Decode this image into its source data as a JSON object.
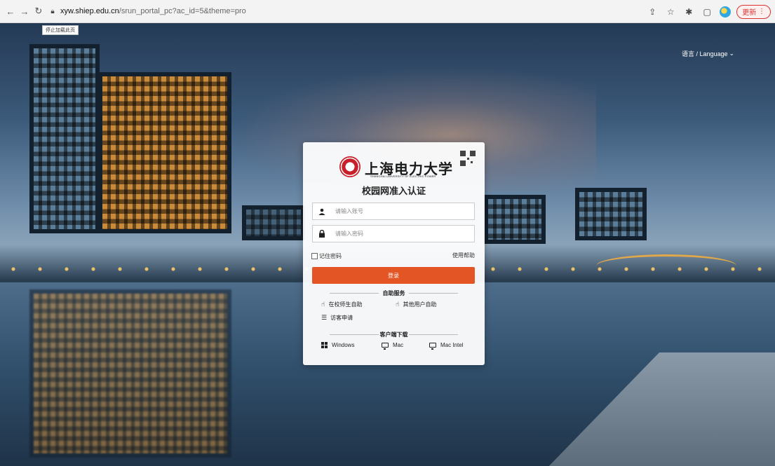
{
  "browser": {
    "url_host": "xyw.shiep.edu.cn",
    "url_path": "/srun_portal_pc?ac_id=5&theme=pro",
    "tooltip": "停止加载此页",
    "update_label": "更新"
  },
  "icons": {
    "back": "back-arrow-icon",
    "forward": "forward-arrow-icon",
    "reload": "reload-icon",
    "lock": "lock-icon",
    "share": "share-icon",
    "bookmark": "star-icon",
    "extensions": "puzzle-icon",
    "sidepanel": "sidepanel-icon",
    "user": "user-icon",
    "password": "lock-icon",
    "self_service": "hand-icon",
    "visitor": "list-icon",
    "windows": "windows-icon",
    "mac": "monitor-icon"
  },
  "language": {
    "label": "语言 / Language",
    "chevron": "⌄"
  },
  "login": {
    "university_name": "上海电力大学",
    "university_en": "SHANGHAI UNIVERSITY OF ELECTRIC POWER",
    "title": "校园网准入认证",
    "username_placeholder": "请输入账号",
    "password_placeholder": "请输入密码",
    "remember_label": "记住密码",
    "help_label": "使用帮助",
    "login_button": "登录"
  },
  "self_service": {
    "title": "自助服务",
    "items": [
      {
        "label": "在校师生自助"
      },
      {
        "label": "其他用户自助"
      },
      {
        "label": "访客申请"
      }
    ]
  },
  "client_download": {
    "title": "客户端下载",
    "items": [
      {
        "label": "Windows"
      },
      {
        "label": "Mac"
      },
      {
        "label": "Mac Intel"
      }
    ]
  },
  "colors": {
    "login_button": "#e35524",
    "update_badge": "#dd3333"
  }
}
